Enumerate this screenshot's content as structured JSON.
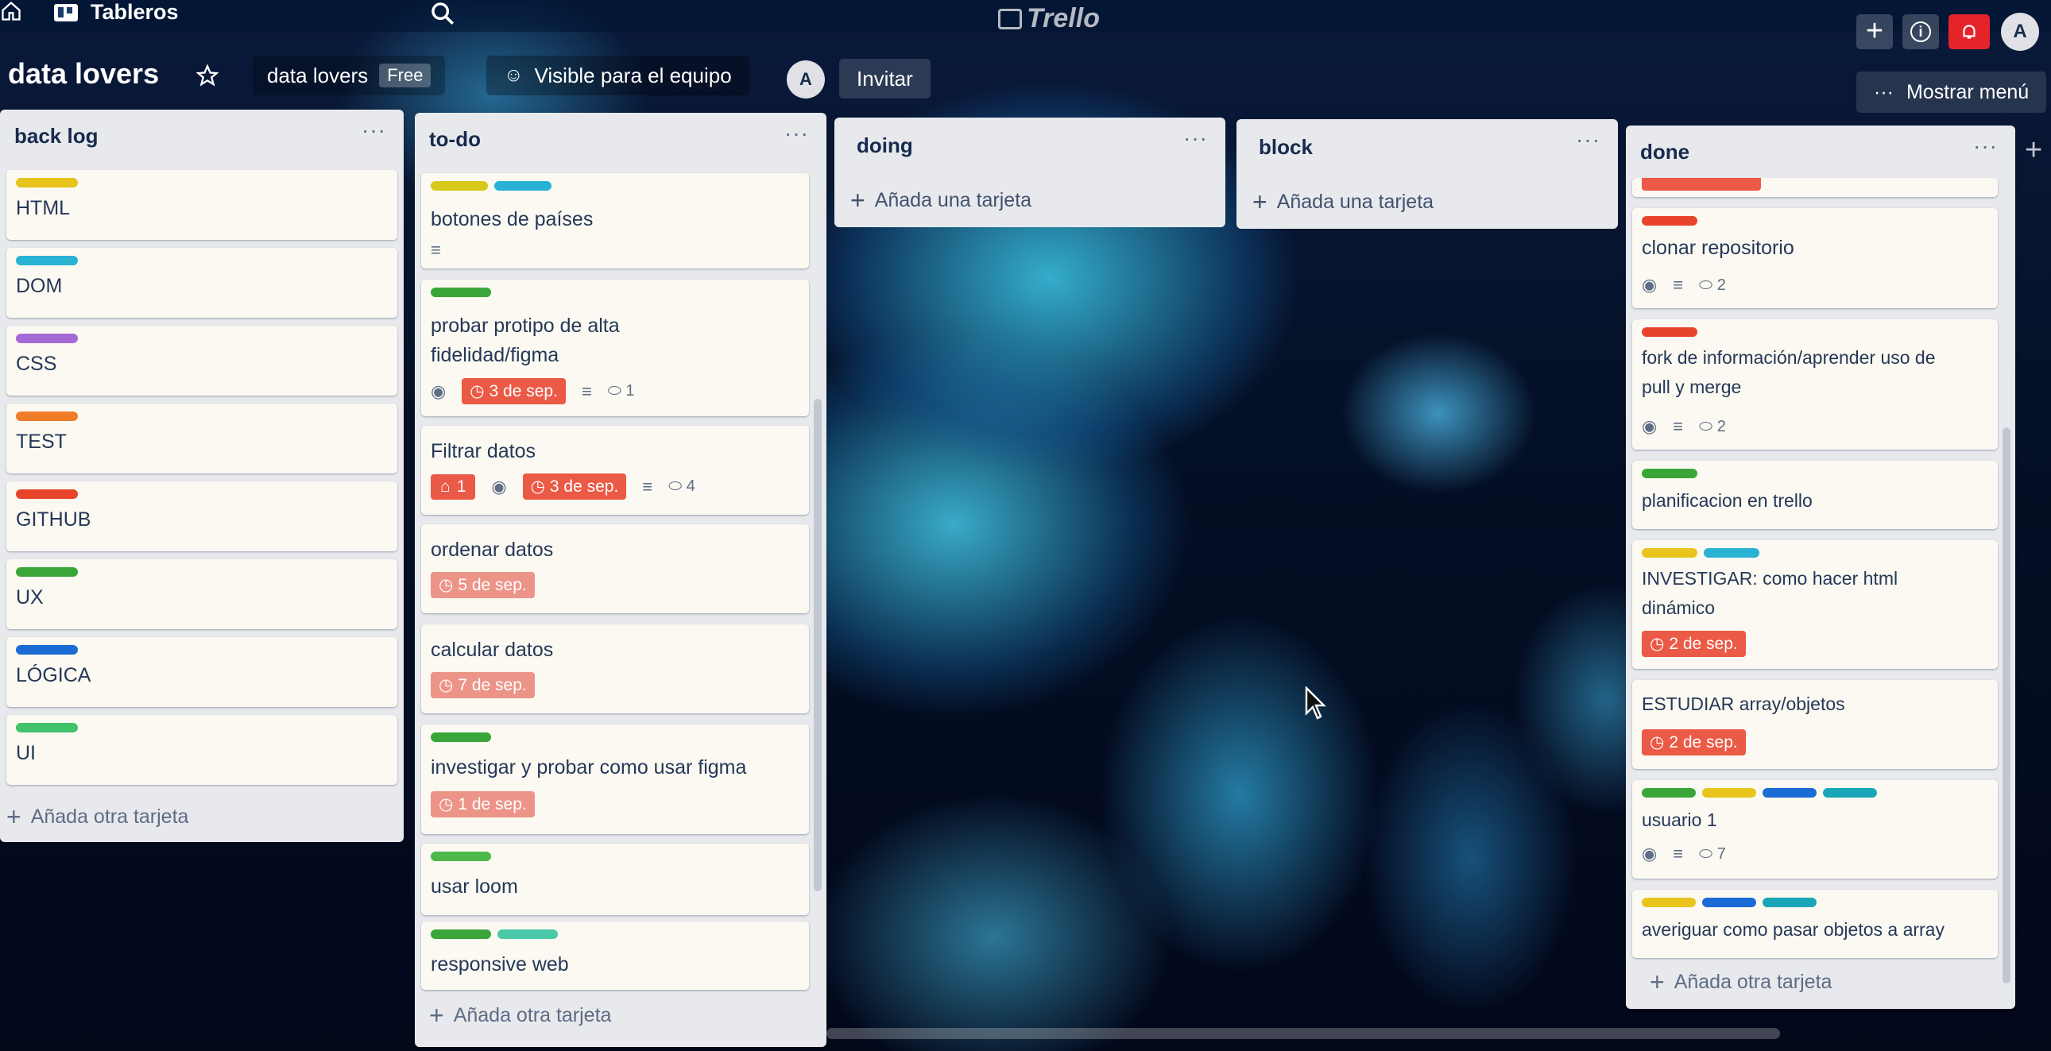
{
  "topbar": {
    "home_label": "",
    "boards_label": "Tableros",
    "logo": "Trello",
    "notification_color": "#e5242a",
    "avatar_initial": "A"
  },
  "board": {
    "name": "data lovers",
    "team_name": "data lovers",
    "plan_badge": "Free",
    "visibility": "Visible para el equipo",
    "member_initial": "A",
    "invite_label": "Invitar",
    "menu_label": "Mostrar menú"
  },
  "lists": {
    "backlog": {
      "title": "back log",
      "menu": "···",
      "cards": [
        {
          "text": "HTML",
          "labels": [
            "#e8c41d"
          ]
        },
        {
          "text": "DOM",
          "labels": [
            "#29b2d4"
          ]
        },
        {
          "text": "CSS",
          "labels": [
            "#a66ad7"
          ]
        },
        {
          "text": "TEST",
          "labels": [
            "#f07c2a"
          ]
        },
        {
          "text": "GITHUB",
          "labels": [
            "#e8442b"
          ]
        },
        {
          "text": "UX",
          "labels": [
            "#3aa63a"
          ]
        },
        {
          "text": "LÓGICA",
          "labels": [
            "#1a6cd4"
          ]
        },
        {
          "text": "UI",
          "labels": [
            "#42c26a"
          ]
        }
      ],
      "add_label": "Añada otra tarjeta"
    },
    "todo": {
      "title": "to-do",
      "menu": "···",
      "cards": [
        {
          "text": "botones de países"
        },
        {
          "text_lines": [
            "probar protipo de alta",
            "fidelidad/figma"
          ],
          "due": "3 de sep.",
          "comments": "1"
        },
        {
          "text": "Filtrar datos",
          "notifications": "1",
          "due": "3 de sep.",
          "comments": "4"
        },
        {
          "text": "ordenar datos",
          "due": "5 de sep."
        },
        {
          "text": "calcular datos",
          "due": "7 de sep."
        },
        {
          "text": "investigar y probar como usar figma",
          "due": "1 de sep."
        },
        {
          "text": "usar loom"
        },
        {
          "text": "responsive web"
        }
      ],
      "add_label": "Añada otra tarjeta"
    },
    "doing": {
      "title": "doing",
      "menu": "···",
      "add_label": "Añada una tarjeta"
    },
    "block": {
      "title": "block",
      "menu": "···",
      "add_label": "Añada una tarjeta"
    },
    "done": {
      "title": "done",
      "menu": "···",
      "cards": [
        {
          "text": "clonar repositorio",
          "comments": "2"
        },
        {
          "text_lines": [
            "fork de información/aprender uso de",
            "pull y merge"
          ],
          "comments": "2"
        },
        {
          "text": "planificacion en trello"
        },
        {
          "text_lines": [
            "INVESTIGAR: como hacer html",
            "dinámico"
          ],
          "due": "2 de sep."
        },
        {
          "text": "ESTUDIAR array/objetos",
          "due": "2 de sep."
        },
        {
          "text": "usuario 1",
          "comments": "7"
        },
        {
          "text": "averiguar como pasar objetos a array"
        }
      ],
      "add_label": "Añada otra tarjeta"
    }
  },
  "add_list_label": "+",
  "colors": {
    "list_bg": "#e7e9ed",
    "card_bg": "#fbf9f1",
    "due_soon": "#ec9488",
    "overdue": "#eb5a46",
    "label_yellow": "#e8c41d",
    "label_sky": "#29b2d4",
    "label_green": "#3aa63a",
    "label_blue": "#1a6cd4",
    "label_red": "#e8442b"
  }
}
